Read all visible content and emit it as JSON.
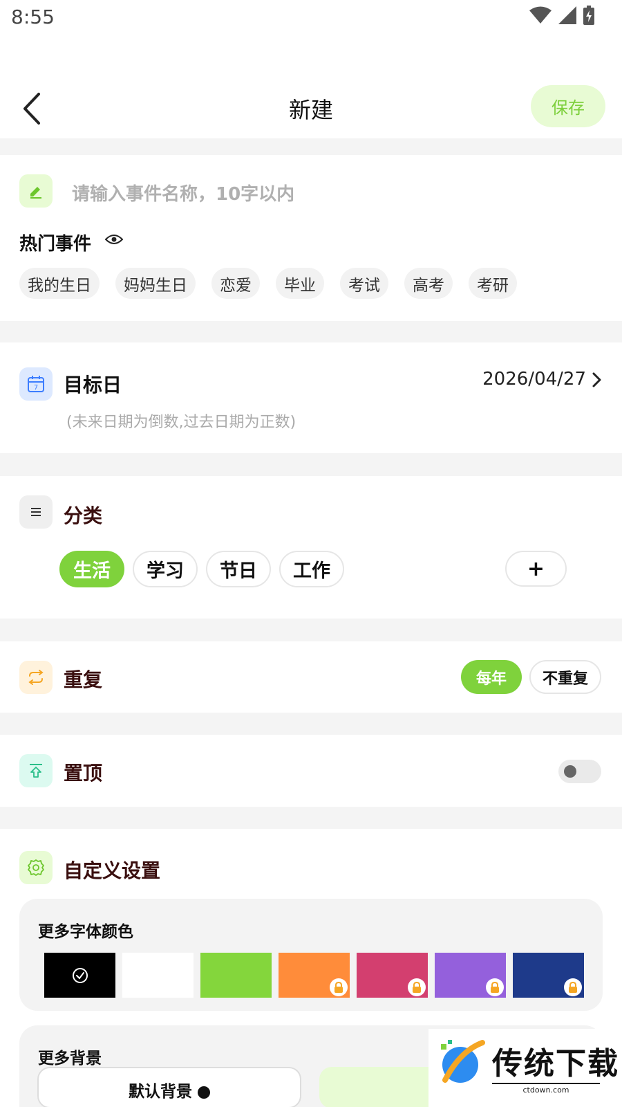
{
  "status_bar": {
    "time": "8:55"
  },
  "nav": {
    "title": "新建",
    "save_label": "保存"
  },
  "name_input": {
    "placeholder": "请输入事件名称，10字以内"
  },
  "hot_events": {
    "title": "热门事件",
    "items": [
      "我的生日",
      "妈妈生日",
      "恋爱",
      "毕业",
      "考试",
      "高考",
      "考研"
    ]
  },
  "target_date": {
    "label": "目标日",
    "value": "2026/04/27",
    "hint": "(未来日期为倒数,过去日期为正数)",
    "icon_text": "7"
  },
  "category": {
    "title": "分类",
    "items": [
      "生活",
      "学习",
      "节日",
      "工作"
    ],
    "selected": "生活",
    "add_label": "+"
  },
  "repeat": {
    "title": "重复",
    "options": [
      "每年",
      "不重复"
    ],
    "selected": "每年"
  },
  "pin": {
    "title": "置顶",
    "enabled": false
  },
  "custom": {
    "title": "自定义设置",
    "font_colors": {
      "title": "更多字体颜色",
      "swatches": [
        {
          "color": "#000000",
          "selected": true,
          "locked": false
        },
        {
          "color": "#ffffff",
          "selected": false,
          "locked": false
        },
        {
          "color": "#84d63c",
          "selected": false,
          "locked": false
        },
        {
          "color": "#ff8c3a",
          "selected": false,
          "locked": true
        },
        {
          "color": "#d33f6f",
          "selected": false,
          "locked": true
        },
        {
          "color": "#9460dc",
          "selected": false,
          "locked": true
        },
        {
          "color": "#1e3a8a",
          "selected": false,
          "locked": true
        }
      ]
    },
    "backgrounds": {
      "title": "更多背景",
      "default_label": "默认背景"
    }
  },
  "watermark": {
    "brand": "传统下载",
    "url": "ctdown.com"
  },
  "colors": {
    "accent": "#7fd23c",
    "accent_light": "#e8fbd4",
    "title_dark": "#3a0f0f"
  }
}
